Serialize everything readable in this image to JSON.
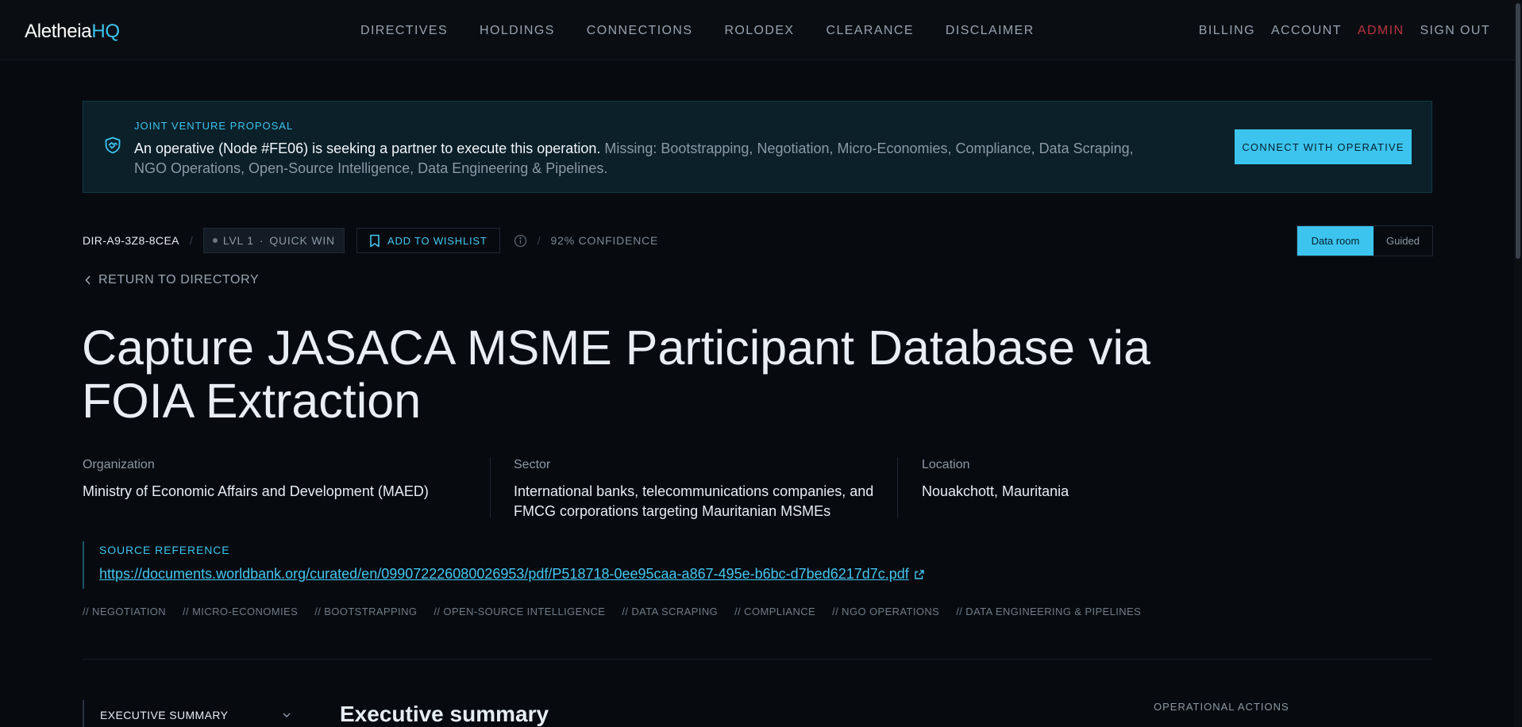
{
  "nav": {
    "brand_primary": "Aletheia",
    "brand_accent": "HQ",
    "center_items": [
      "DIRECTIVES",
      "HOLDINGS",
      "CONNECTIONS",
      "ROLODEX",
      "CLEARANCE",
      "DISCLAIMER"
    ],
    "right_items": {
      "billing": "BILLING",
      "account": "ACCOUNT",
      "admin": "ADMIN",
      "sign_out": "SIGN OUT"
    }
  },
  "banner": {
    "icon": "handshake-shield-icon",
    "kicker": "JOINT VENTURE PROPOSAL",
    "headline": "An operative (Node #FE06) is seeking a partner to execute this operation.",
    "missing": " Missing: Bootstrapping, Negotiation, Micro-Economies, Compliance, Data Scraping, NGO Operations, Open-Source Intelligence, Data Engineering & Pipelines.",
    "button": "CONNECT WITH OPERATIVE"
  },
  "meta": {
    "directive_id": "DIR-A9-3Z8-8CEA",
    "level": "LVL 1",
    "level_tag": "QUICK WIN",
    "wishlist_button": "ADD TO WISHLIST",
    "confidence": "92% CONFIDENCE",
    "view_modes": {
      "active": "Data room",
      "inactive": "Guided"
    }
  },
  "return_link": "RETURN TO DIRECTORY",
  "title": "Capture JASACA MSME Participant Database via FOIA Extraction",
  "details": {
    "organization": {
      "label": "Organization",
      "value": "Ministry of Economic Affairs and Development (MAED)"
    },
    "sector": {
      "label": "Sector",
      "value": "International banks, telecommunications companies, and FMCG corporations targeting Mauritanian MSMEs"
    },
    "location": {
      "label": "Location",
      "value": "Nouakchott, Mauritania"
    }
  },
  "source": {
    "label": "SOURCE REFERENCE",
    "url": "https://documents.worldbank.org/curated/en/099072226080026953/pdf/P518718-0ee95caa-a867-495e-b6bc-d7bed6217d7c.pdf"
  },
  "tags": [
    "// NEGOTIATION",
    "// MICRO-ECONOMIES",
    "// BOOTSTRAPPING",
    "// OPEN-SOURCE INTELLIGENCE",
    "// DATA SCRAPING",
    "// COMPLIANCE",
    "// NGO OPERATIONS",
    "// DATA ENGINEERING & PIPELINES"
  ],
  "sections": {
    "side_nav_item": "EXECUTIVE SUMMARY",
    "main_heading": "Executive summary",
    "ops_label": "OPERATIONAL ACTIONS"
  },
  "colors": {
    "accent": "#3cc4ee",
    "admin": "#b8343e",
    "background": "#070b10",
    "banner_bg": "#0b2029"
  }
}
